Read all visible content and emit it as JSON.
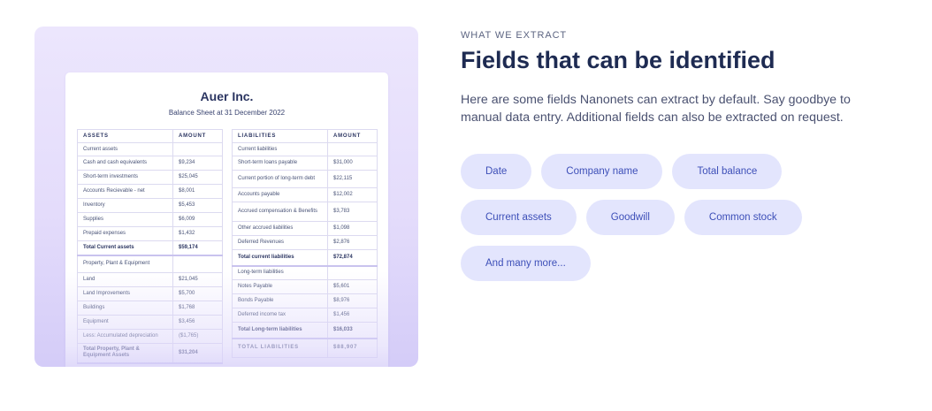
{
  "preview": {
    "company": "Auer Inc.",
    "subtitle": "Balance Sheet at 31 December 2022",
    "assets": {
      "headers": [
        "ASSETS",
        "AMOUNT"
      ],
      "rows": [
        {
          "label": "Current assets",
          "amount": "",
          "h": 15
        },
        {
          "label": "Cash and cash equivalents",
          "amount": "$9,234",
          "h": 16
        },
        {
          "label": "Short-term investments",
          "amount": "$25,045",
          "h": 16
        },
        {
          "label": "Accounts Recievable - net",
          "amount": "$8,001",
          "h": 16
        },
        {
          "label": "Inventory",
          "amount": "$5,453",
          "h": 16
        },
        {
          "label": "Supplies",
          "amount": "$6,009",
          "h": 16
        },
        {
          "label": "Prepaid expenses",
          "amount": "$1,432",
          "h": 16
        },
        {
          "label": "Total Current assets",
          "amount": "$59,174",
          "h": 16,
          "total": true
        },
        {
          "label": "Property, Plant & Equipment",
          "amount": "",
          "h": 20
        },
        {
          "label": "Land",
          "amount": "$21,045",
          "h": 16
        },
        {
          "label": "Land Improvements",
          "amount": "$5,700",
          "h": 16
        },
        {
          "label": "Buildings",
          "amount": "$1,768",
          "h": 16
        },
        {
          "label": "Equipment",
          "amount": "$3,456",
          "h": 16
        },
        {
          "label": "Less: Accumulated depreciation",
          "amount": "($1,765)",
          "h": 16
        },
        {
          "label": "Total Property, Plant & Equipment Assets",
          "amount": "$31,204",
          "h": 22,
          "total": true
        }
      ]
    },
    "liabilities": {
      "headers": [
        "LIABILITIES",
        "AMOUNT"
      ],
      "rows": [
        {
          "label": "Current liabilities",
          "amount": "",
          "h": 15
        },
        {
          "label": "Short-term loans payable",
          "amount": "$31,000",
          "h": 16
        },
        {
          "label": "Current portion of long-term debt",
          "amount": "$22,115",
          "h": 20
        },
        {
          "label": "Accounts payable",
          "amount": "$12,002",
          "h": 16
        },
        {
          "label": "Accrued compensation & Benefits",
          "amount": "$3,783",
          "h": 22
        },
        {
          "label": "Other accrued liabilities",
          "amount": "$1,098",
          "h": 16
        },
        {
          "label": "Deferred Revenues",
          "amount": "$2,876",
          "h": 16
        },
        {
          "label": "Total current liabilities",
          "amount": "$72,874",
          "h": 18,
          "total": true
        },
        {
          "label": "Long-term liabilities",
          "amount": "",
          "h": 16
        },
        {
          "label": "Notes Payable",
          "amount": "$5,601",
          "h": 16
        },
        {
          "label": "Bonds Payable",
          "amount": "$8,976",
          "h": 16
        },
        {
          "label": "Deferred income tax",
          "amount": "$1,456",
          "h": 16
        },
        {
          "label": "Total Long-term liabilities",
          "amount": "$16,033",
          "h": 18,
          "total": true
        },
        {
          "label": "TOTAL LIABILITIES",
          "amount": "$88,907",
          "h": 22,
          "spaced": true
        }
      ]
    }
  },
  "section": {
    "eyebrow": "WHAT WE EXTRACT",
    "title": "Fields that can be identified",
    "description": "Here are some fields Nanonets can extract by default. Say goodbye to manual data entry. Additional fields can also be extracted on request."
  },
  "fields": [
    [
      "Date",
      "Company name",
      "Total balance"
    ],
    [
      "Current assets",
      "Goodwill",
      "Common stock"
    ],
    [
      "And many more..."
    ]
  ],
  "colors": {
    "chip_bg": "#e3e5fd",
    "chip_text": "#3d4fb8",
    "heading": "#1e2b52"
  }
}
